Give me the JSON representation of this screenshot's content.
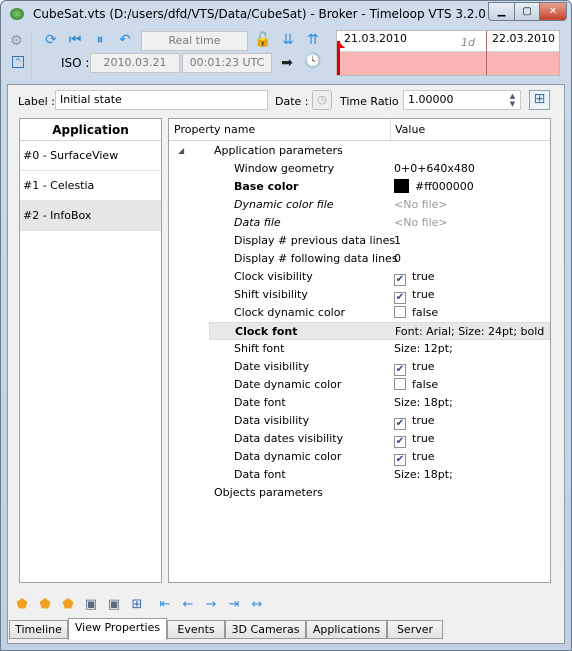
{
  "window": {
    "title": "CubeSat.vts (D:/users/dfd/VTS/Data/CubeSat) - Broker - Timeloop VTS 3.2.0",
    "minimize": "▁",
    "maximize": "▢",
    "close": "✕"
  },
  "toolbar": {
    "real_time": "Real time",
    "iso_label": "ISO :",
    "date": "2010.03.21",
    "time": "00:01:23 UTC"
  },
  "timeline": {
    "date1": "21.03.2010",
    "scale": "1d",
    "date2": "22.03.2010",
    "bar_color": "#f9b4b4"
  },
  "form": {
    "label_label": "Label :",
    "label_value": "Initial state",
    "date_label": "Date :",
    "ratio_label": "Time Ratio :",
    "ratio_value": "1.00000"
  },
  "applications": {
    "header": "Application",
    "items": [
      "#0 - SurfaceView",
      "#1 - Celestia",
      "#2 - InfoBox"
    ],
    "selected": 2
  },
  "properties": {
    "col_name": "Property name",
    "col_value": "Value",
    "group1": "Application parameters",
    "group2": "Objects parameters",
    "rows": [
      {
        "name": "Window geometry",
        "value": "0+0+640x480"
      },
      {
        "name": "Base color",
        "value": "#ff000000",
        "bold": true,
        "swatch": "#000000"
      },
      {
        "name": "Dynamic color file",
        "value": "<No file>",
        "italic": true
      },
      {
        "name": "Data file",
        "value": "<No file>",
        "italic": true
      },
      {
        "name": "Display # previous data lines",
        "value": "1"
      },
      {
        "name": "Display # following data lines",
        "value": "0"
      },
      {
        "name": "Clock visibility",
        "value": "true",
        "check": true
      },
      {
        "name": "Shift visibility",
        "value": "true",
        "check": true
      },
      {
        "name": "Clock dynamic color",
        "value": "false",
        "check": false
      },
      {
        "name": "Clock font",
        "value": "Font: Arial; Size: 24pt; bold",
        "bold": true,
        "selected": true
      },
      {
        "name": "Shift font",
        "value": "Size: 12pt;"
      },
      {
        "name": "Date visibility",
        "value": "true",
        "check": true
      },
      {
        "name": "Date dynamic color",
        "value": "false",
        "check": false
      },
      {
        "name": "Date font",
        "value": "Size: 18pt;"
      },
      {
        "name": "Data visibility",
        "value": "true",
        "check": true
      },
      {
        "name": "Data dates visibility",
        "value": "true",
        "check": true
      },
      {
        "name": "Data dynamic color",
        "value": "true",
        "check": true
      },
      {
        "name": "Data font",
        "value": "Size: 18pt;"
      }
    ]
  },
  "tabs": [
    "Timeline",
    "View Properties",
    "Events",
    "3D Cameras",
    "Applications",
    "Server"
  ],
  "active_tab": 1
}
